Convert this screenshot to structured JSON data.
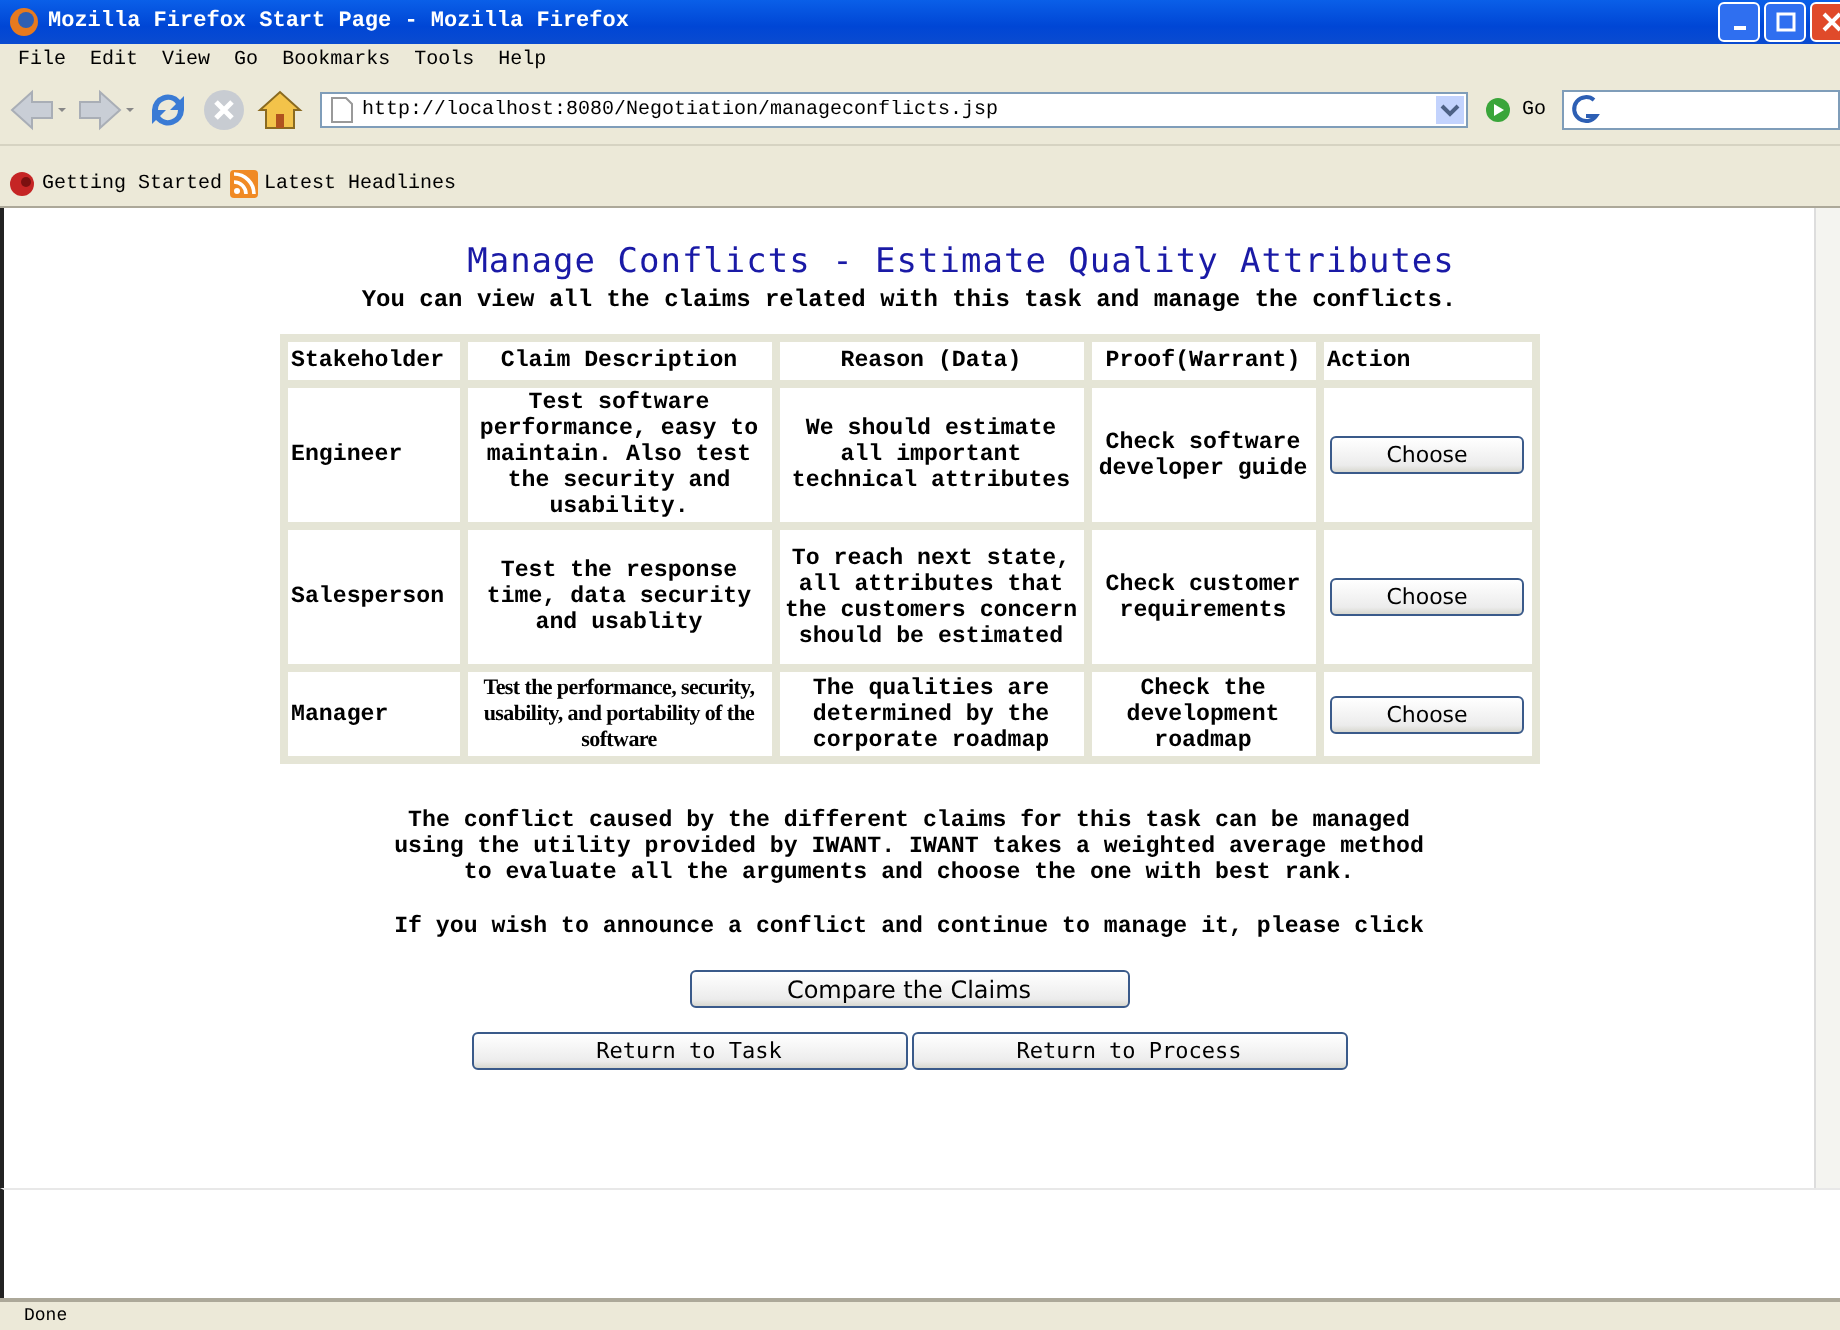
{
  "window": {
    "title": "Mozilla Firefox Start Page - Mozilla Firefox"
  },
  "menu": [
    "File",
    "Edit",
    "View",
    "Go",
    "Bookmarks",
    "Tools",
    "Help"
  ],
  "address": {
    "value": "http://localhost:8080/Negotiation/manageconflicts.jsp"
  },
  "go_label": "Go",
  "bookmarks": [
    {
      "label": "Getting Started",
      "kind": "page"
    },
    {
      "label": "Latest Headlines",
      "kind": "feed"
    }
  ],
  "page": {
    "heading": "Manage Conflicts - Estimate Quality Attributes",
    "subheading": "You can view all the claims related with this task and manage the conflicts.",
    "table": {
      "columns": [
        "Stakeholder",
        "Claim Description",
        "Reason (Data)",
        "Proof(Warrant)",
        "Action"
      ],
      "rows": [
        {
          "stakeholder": "Engineer",
          "claim": "Test software performance, easy to maintain. Also test the security and usability.",
          "reason": "We should estimate all important technical attributes",
          "proof": "Check software developer guide",
          "action": "Choose"
        },
        {
          "stakeholder": "Salesperson",
          "claim": "Test the response time, data security and usablity",
          "reason": "To reach next state, all attributes that the customers concern should be estimated",
          "proof": "Check customer requirements",
          "action": "Choose"
        },
        {
          "stakeholder": "Manager",
          "claim": "Test the performance, security, usability, and portability of the software",
          "reason": "The qualities are determined by the corporate roadmap",
          "proof": "Check the development roadmap",
          "action": "Choose"
        }
      ]
    },
    "explanation": "The conflict caused by the different claims for this task can be managed using the utility provided by IWANT. IWANT takes a weighted average method to evaluate all the arguments and choose the one with best rank.",
    "prompt": "If you wish to announce a conflict and continue to manage it, please click",
    "compare_button": "Compare the Claims",
    "nav_buttons": [
      "Return to Task",
      "Return to Process"
    ]
  },
  "status_bar": "Done"
}
